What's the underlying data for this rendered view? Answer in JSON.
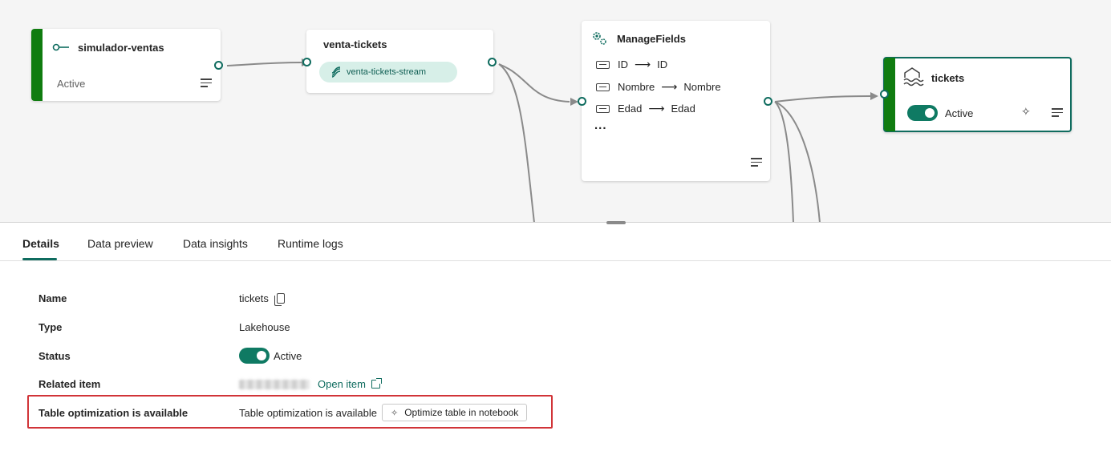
{
  "nodes": {
    "source": {
      "title": "simulador-ventas",
      "status": "Active"
    },
    "stream": {
      "title": "venta-tickets",
      "pill": "venta-tickets-stream"
    },
    "transform": {
      "title": "ManageFields",
      "fields": [
        {
          "from": "ID",
          "to": "ID"
        },
        {
          "from": "Nombre",
          "to": "Nombre"
        },
        {
          "from": "Edad",
          "to": "Edad"
        }
      ],
      "more": "..."
    },
    "destination": {
      "title": "tickets",
      "status": "Active"
    }
  },
  "tabs": [
    {
      "label": "Details",
      "active": true
    },
    {
      "label": "Data preview",
      "active": false
    },
    {
      "label": "Data insights",
      "active": false
    },
    {
      "label": "Runtime logs",
      "active": false
    }
  ],
  "details": {
    "name_label": "Name",
    "name_value": "tickets",
    "type_label": "Type",
    "type_value": "Lakehouse",
    "status_label": "Status",
    "status_value": "Active",
    "related_label": "Related item",
    "related_link": "Open item",
    "optimization_label": "Table optimization is available",
    "optimization_value": "Table optimization is available",
    "optimization_button": "Optimize table in notebook"
  },
  "colors": {
    "accent": "#0f6c5f",
    "active_bar": "#107c10",
    "highlight": "#d13438"
  }
}
